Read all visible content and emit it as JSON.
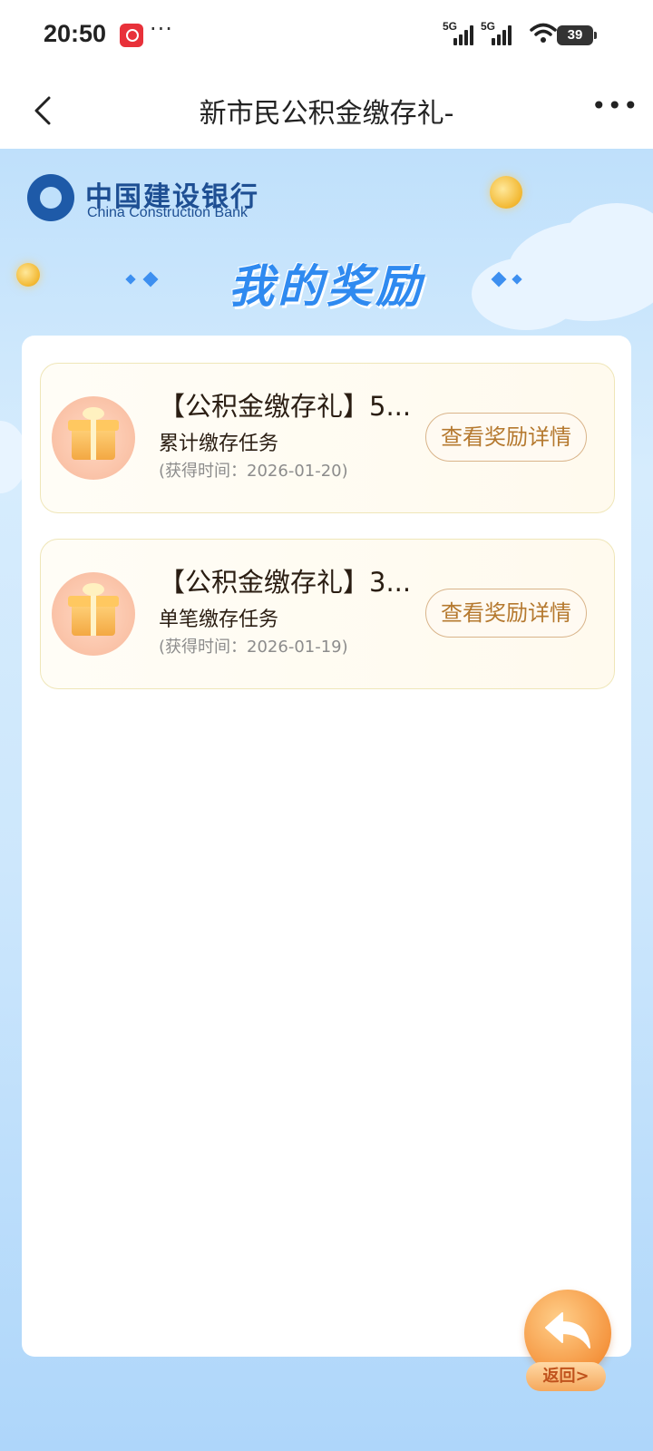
{
  "status_bar": {
    "time": "20:50",
    "signal1_label": "5G",
    "signal2_label": "5G",
    "battery": "39"
  },
  "nav": {
    "title": "新市民公积金缴存礼-",
    "back_icon": "chevron-left-icon",
    "more_icon": "more-dots-icon"
  },
  "header": {
    "bank_name_cn": "中国建设银行",
    "bank_name_en": "China Construction Bank",
    "page_title": "我的奖励"
  },
  "rewards": [
    {
      "title": "【公积金缴存礼】5...",
      "subtitle": "累计缴存任务",
      "time": "(获得时间：2026-01-20)",
      "button_label": "查看奖励详情"
    },
    {
      "title": "【公积金缴存礼】3...",
      "subtitle": "单笔缴存任务",
      "time": "(获得时间：2026-01-19)",
      "button_label": "查看奖励详情"
    }
  ],
  "return_button": {
    "label": "返回>"
  },
  "colors": {
    "accent_blue": "#2f8af0",
    "button_text": "#b5792f",
    "bank_blue": "#1e4f93"
  }
}
